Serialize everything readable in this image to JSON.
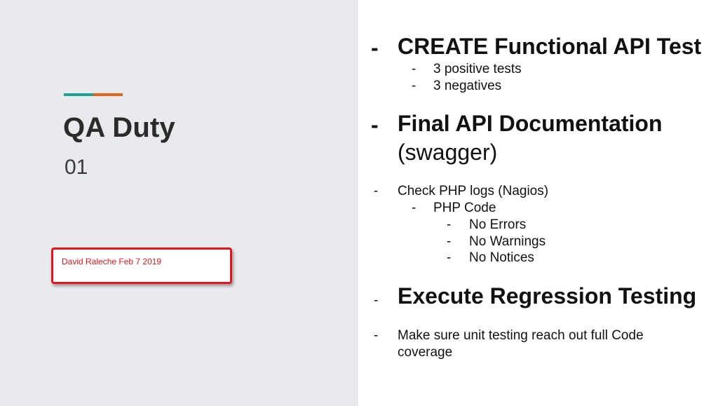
{
  "title": "QA Duty",
  "subtitle": "01",
  "author": "David Raleche Feb 7 2019",
  "colors": {
    "accent_teal": "#1fa38f",
    "accent_orange": "#e2671b",
    "left_bg": "#e8eaed",
    "annotation_red": "#e8141b"
  },
  "bullet_dash": "-",
  "items": {
    "create_test": "CREATE Functional API Test",
    "positive_tests": "3 positive tests",
    "negatives": "3 negatives",
    "final_doc": "Final API Documentation",
    "swagger": "(swagger)",
    "check_php_logs": "Check PHP logs (Nagios)",
    "php_code": "PHP Code",
    "no_errors": "No Errors",
    "no_warnings": "No Warnings",
    "no_notices": "No Notices",
    "regression": "Execute Regression Testing",
    "unit_testing_line1": "Make sure unit testing reach out full Code",
    "unit_testing_line2": "coverage"
  }
}
